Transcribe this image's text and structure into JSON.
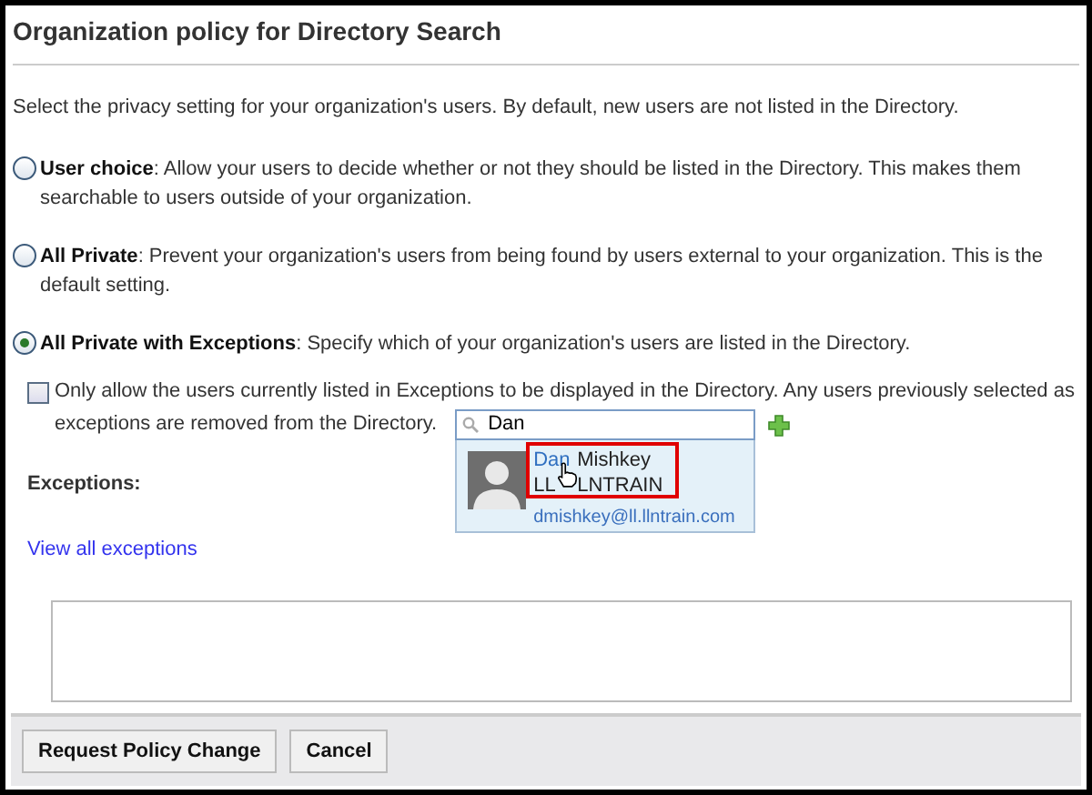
{
  "title": "Organization policy for Directory Search",
  "intro": "Select the privacy setting for your organization's users. By default, new users are not listed in the Directory.",
  "options": [
    {
      "text": "**User choice**: Allow your users to decide whether or not they should be listed in the Directory. This makes them searchable to users outside of your organization.",
      "selected": false
    },
    {
      "text": "**All Private**: Prevent your organization's users from being found by users external to your organization. This is the default setting.",
      "selected": false
    },
    {
      "text": "**All Private with Exceptions**: Specify which of your organization's users are listed in the Directory.",
      "selected": true
    }
  ],
  "only_allow": {
    "lines": [
      "Only allow the users currently listed in Exceptions to be displayed in the Directory. Any users previously selected as",
      "exceptions are removed from the Directory."
    ],
    "checked": false
  },
  "search": {
    "value": "Dan"
  },
  "suggestion": {
    "name_parts": [
      "Dan",
      "Mishkey"
    ],
    "org_parts": [
      "LL",
      "LNTRAIN"
    ],
    "email": "dmishkey@ll.llntrain.com"
  },
  "exceptions_label": "Exceptions:",
  "view_all": "View all exceptions",
  "buttons": [
    "Request Policy Change",
    "Cancel"
  ]
}
